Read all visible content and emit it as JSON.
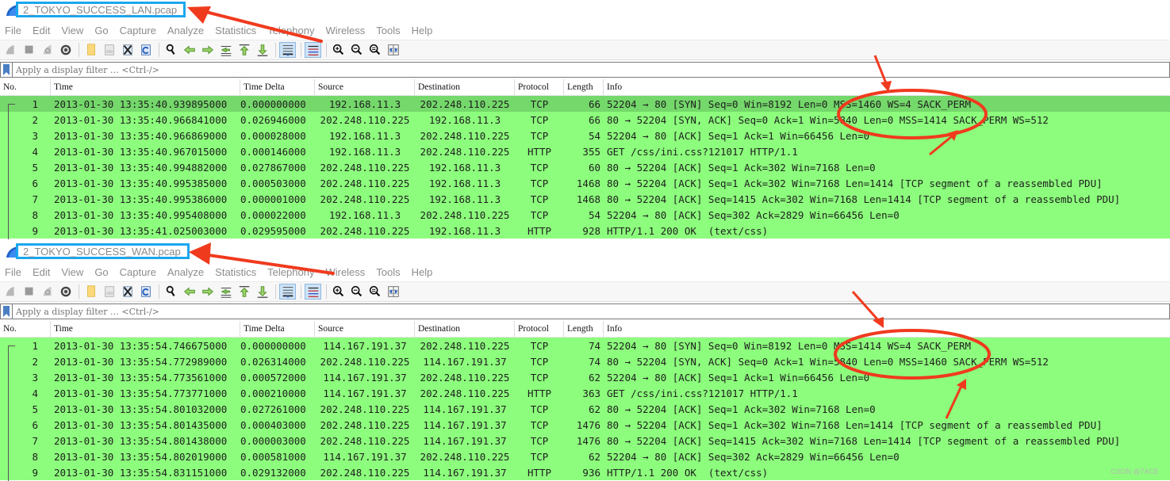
{
  "menu": [
    "File",
    "Edit",
    "View",
    "Go",
    "Capture",
    "Analyze",
    "Statistics",
    "Telephony",
    "Wireless",
    "Tools",
    "Help"
  ],
  "toolbar_icons": [
    "shark-fin-start-icon",
    "stop-capture-icon",
    "restart-capture-icon",
    "capture-options-gear-icon",
    "open-file-icon",
    "save-file-icon",
    "close-file-icon",
    "reload-file-icon",
    "find-packet-icon",
    "go-back-icon",
    "go-forward-icon",
    "go-to-packet-icon",
    "go-first-icon",
    "go-last-icon",
    "autoscroll-icon",
    "colorize-icon",
    "zoom-in-icon",
    "zoom-out-icon",
    "zoom-normal-icon",
    "resize-columns-icon"
  ],
  "filter": {
    "placeholder": "Apply a display filter … <Ctrl-/>"
  },
  "columns": [
    "No.",
    "Time",
    "Time Delta",
    "Source",
    "Destination",
    "Protocol",
    "Length",
    "Info"
  ],
  "panes": [
    {
      "title": "2_TOKYO_SUCCESS_LAN.pcap",
      "rows": [
        [
          "1",
          "2013-01-30 13:35:40.939895000",
          "0.000000000",
          "192.168.11.3",
          "202.248.110.225",
          "TCP",
          "66",
          "52204 → 80 [SYN] Seq=0 Win=8192 Len=0 MSS=1460 WS=4 SACK_PERM"
        ],
        [
          "2",
          "2013-01-30 13:35:40.966841000",
          "0.026946000",
          "202.248.110.225",
          "192.168.11.3",
          "TCP",
          "66",
          "80 → 52204 [SYN, ACK] Seq=0 Ack=1 Win=5840 Len=0 MSS=1414 SACK_PERM WS=512"
        ],
        [
          "3",
          "2013-01-30 13:35:40.966869000",
          "0.000028000",
          "192.168.11.3",
          "202.248.110.225",
          "TCP",
          "54",
          "52204 → 80 [ACK] Seq=1 Ack=1 Win=66456 Len=0"
        ],
        [
          "4",
          "2013-01-30 13:35:40.967015000",
          "0.000146000",
          "192.168.11.3",
          "202.248.110.225",
          "HTTP",
          "355",
          "GET /css/ini.css?121017 HTTP/1.1"
        ],
        [
          "5",
          "2013-01-30 13:35:40.994882000",
          "0.027867000",
          "202.248.110.225",
          "192.168.11.3",
          "TCP",
          "60",
          "80 → 52204 [ACK] Seq=1 Ack=302 Win=7168 Len=0"
        ],
        [
          "6",
          "2013-01-30 13:35:40.995385000",
          "0.000503000",
          "202.248.110.225",
          "192.168.11.3",
          "TCP",
          "1468",
          "80 → 52204 [ACK] Seq=1 Ack=302 Win=7168 Len=1414 [TCP segment of a reassembled PDU]"
        ],
        [
          "7",
          "2013-01-30 13:35:40.995386000",
          "0.000001000",
          "202.248.110.225",
          "192.168.11.3",
          "TCP",
          "1468",
          "80 → 52204 [ACK] Seq=1415 Ack=302 Win=7168 Len=1414 [TCP segment of a reassembled PDU]"
        ],
        [
          "8",
          "2013-01-30 13:35:40.995408000",
          "0.000022000",
          "192.168.11.3",
          "202.248.110.225",
          "TCP",
          "54",
          "52204 → 80 [ACK] Seq=302 Ack=2829 Win=66456 Len=0"
        ],
        [
          "9",
          "2013-01-30 13:35:41.025003000",
          "0.029595000",
          "202.248.110.225",
          "192.168.11.3",
          "HTTP",
          "928",
          "HTTP/1.1 200 OK  (text/css)"
        ]
      ],
      "selected_row": 0
    },
    {
      "title": "2_TOKYO_SUCCESS_WAN.pcap",
      "rows": [
        [
          "1",
          "2013-01-30 13:35:54.746675000",
          "0.000000000",
          "114.167.191.37",
          "202.248.110.225",
          "TCP",
          "74",
          "52204 → 80 [SYN] Seq=0 Win=8192 Len=0 MSS=1414 WS=4 SACK_PERM"
        ],
        [
          "2",
          "2013-01-30 13:35:54.772989000",
          "0.026314000",
          "202.248.110.225",
          "114.167.191.37",
          "TCP",
          "74",
          "80 → 52204 [SYN, ACK] Seq=0 Ack=1 Win=5840 Len=0 MSS=1460 SACK_PERM WS=512"
        ],
        [
          "3",
          "2013-01-30 13:35:54.773561000",
          "0.000572000",
          "114.167.191.37",
          "202.248.110.225",
          "TCP",
          "62",
          "52204 → 80 [ACK] Seq=1 Ack=1 Win=66456 Len=0"
        ],
        [
          "4",
          "2013-01-30 13:35:54.773771000",
          "0.000210000",
          "114.167.191.37",
          "202.248.110.225",
          "HTTP",
          "363",
          "GET /css/ini.css?121017 HTTP/1.1"
        ],
        [
          "5",
          "2013-01-30 13:35:54.801032000",
          "0.027261000",
          "202.248.110.225",
          "114.167.191.37",
          "TCP",
          "62",
          "80 → 52204 [ACK] Seq=1 Ack=302 Win=7168 Len=0"
        ],
        [
          "6",
          "2013-01-30 13:35:54.801435000",
          "0.000403000",
          "202.248.110.225",
          "114.167.191.37",
          "TCP",
          "1476",
          "80 → 52204 [ACK] Seq=1 Ack=302 Win=7168 Len=1414 [TCP segment of a reassembled PDU]"
        ],
        [
          "7",
          "2013-01-30 13:35:54.801438000",
          "0.000003000",
          "202.248.110.225",
          "114.167.191.37",
          "TCP",
          "1476",
          "80 → 52204 [ACK] Seq=1415 Ack=302 Win=7168 Len=1414 [TCP segment of a reassembled PDU]"
        ],
        [
          "8",
          "2013-01-30 13:35:54.802019000",
          "0.000581000",
          "114.167.191.37",
          "202.248.110.225",
          "TCP",
          "62",
          "52204 → 80 [ACK] Seq=302 Ack=2829 Win=66456 Len=0"
        ],
        [
          "9",
          "2013-01-30 13:35:54.831151000",
          "0.029132000",
          "202.248.110.225",
          "114.167.191.37",
          "HTTP",
          "936",
          "HTTP/1.1 200 OK  (text/css)"
        ]
      ],
      "selected_row": -1
    }
  ],
  "colors": {
    "tcp_row": "#8cfd7c",
    "selected_row": "#74d86a",
    "annotation": "#f03a1e",
    "title_highlight": "#1aa7ee"
  },
  "watermark": "CSDN @7ACE"
}
